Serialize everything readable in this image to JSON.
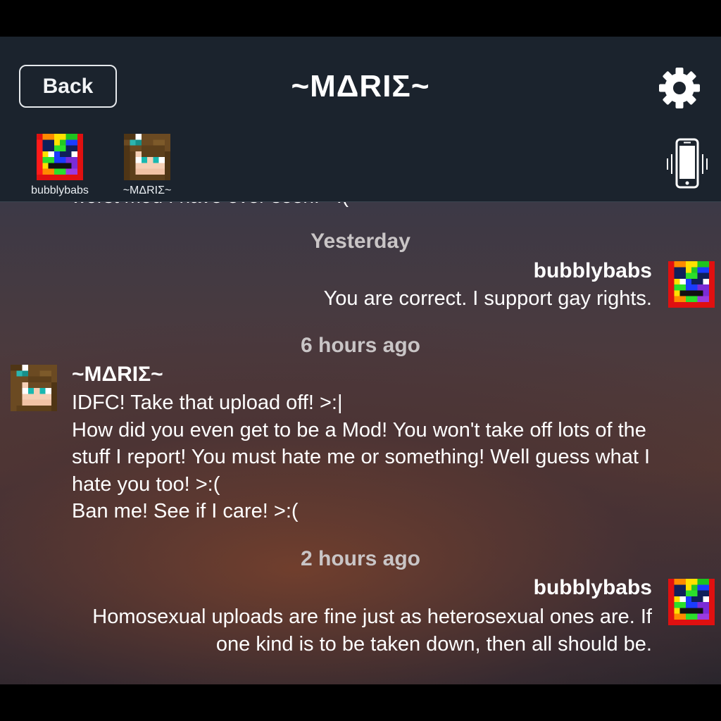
{
  "header": {
    "back_label": "Back",
    "title": "~MΔRIΣ~",
    "settings_icon": "gear-icon",
    "vibrate_icon": "phone-vibrate-icon"
  },
  "participants": [
    {
      "name": "bubblybabs",
      "avatar": "rainbow-pixel-avatar"
    },
    {
      "name": "~MΔRIΣ~",
      "avatar": "girl-pixel-avatar"
    }
  ],
  "chat": {
    "clipped_previous_message": "worst mod I have ever seen! >:(",
    "groups": [
      {
        "time": "Yesterday",
        "sender": "bubblybabs",
        "lines": [
          "You are correct.  I support gay rights."
        ]
      },
      {
        "time": "6 hours ago",
        "sender": "~MΔRIΣ~",
        "lines": [
          "IDFC! Take that upload off! >:|",
          "How did you even get to be a Mod! You won't take off lots of the",
          "stuff I report! You must hate me or something! Well guess what I",
          "hate you too! >:(",
          "Ban me! See if I care! >:("
        ]
      },
      {
        "time": "2 hours ago",
        "sender": "bubblybabs",
        "lines": [
          "Homosexual uploads are fine just as heterosexual ones are.  If",
          "one kind is to be taken down, then all should be."
        ]
      }
    ]
  },
  "colors": {
    "header_bg": "#1b232d",
    "time_label": "#c9c5c6",
    "text": "#ffffff"
  }
}
